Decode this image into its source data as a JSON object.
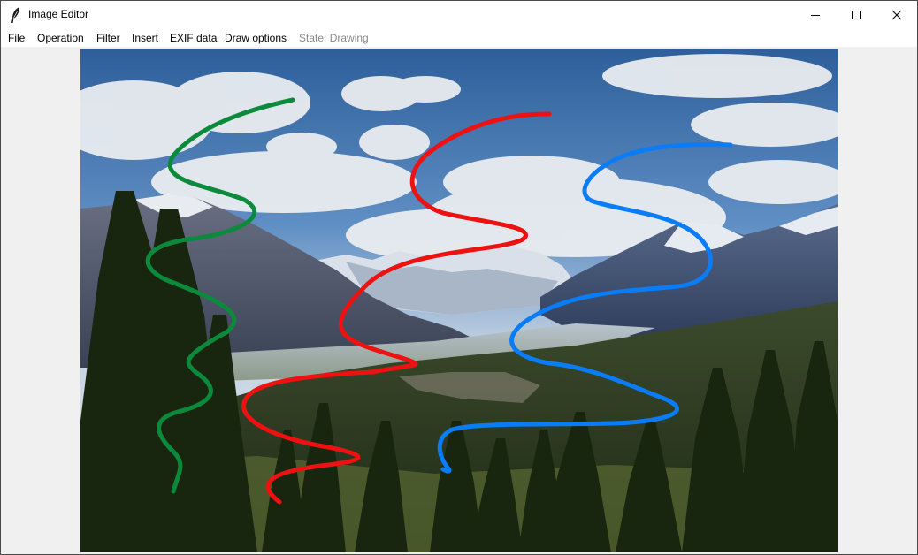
{
  "window": {
    "title": "Image Editor",
    "controls": {
      "minimize": "minimize-icon",
      "maximize": "maximize-icon",
      "close": "close-icon"
    }
  },
  "menu": {
    "file": "File",
    "operation": "Operation",
    "filter": "Filter",
    "insert": "Insert",
    "exif": "EXIF data",
    "draw_options": "Draw options",
    "state": "State: Drawing"
  },
  "canvas": {
    "image": "mountain valley landscape with evergreen trees",
    "stroke_colors": [
      "#0b8a3c",
      "#ee1111",
      "#0a7cf5"
    ]
  }
}
